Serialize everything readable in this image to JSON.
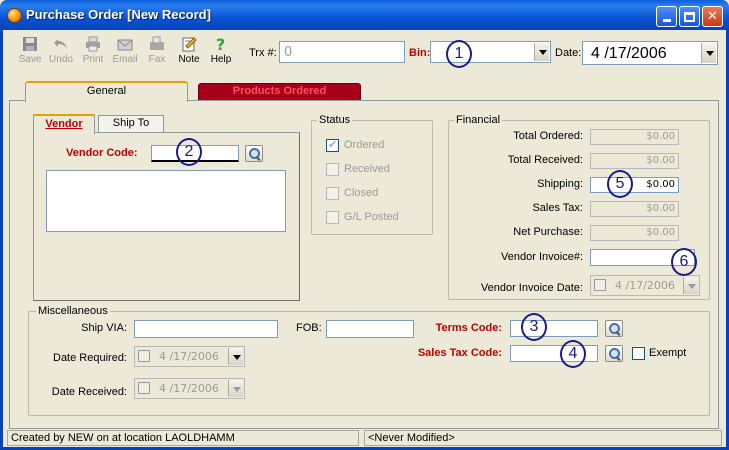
{
  "window": {
    "title": "Purchase Order [New Record]"
  },
  "toolbar": {
    "buttons": [
      {
        "label": "Save",
        "icon": "save-icon",
        "enabled": false
      },
      {
        "label": "Undo",
        "icon": "undo-icon",
        "enabled": false
      },
      {
        "label": "Print",
        "icon": "print-icon",
        "enabled": false
      },
      {
        "label": "Email",
        "icon": "email-icon",
        "enabled": false
      },
      {
        "label": "Fax",
        "icon": "fax-icon",
        "enabled": false
      },
      {
        "label": "Note",
        "icon": "note-icon",
        "enabled": true
      },
      {
        "label": "Help",
        "icon": "help-icon",
        "enabled": true
      }
    ],
    "trx_label": "Trx #:",
    "trx_value": "0",
    "bin_label": "Bin:",
    "bin_value": "",
    "date_label": "Date:",
    "date_value": "4 /17/2006"
  },
  "tabs": [
    {
      "label": "General",
      "active": true
    },
    {
      "label": "Products Ordered",
      "active": false
    }
  ],
  "vendor_tabs": [
    {
      "label": "Vendor",
      "active": true
    },
    {
      "label": "Ship To",
      "active": false
    }
  ],
  "vendor": {
    "code_label": "Vendor Code:",
    "code_value": "",
    "address": ""
  },
  "status": {
    "title": "Status",
    "items": [
      {
        "label": "Ordered",
        "checked": true
      },
      {
        "label": "Received",
        "checked": false
      },
      {
        "label": "Closed",
        "checked": false
      },
      {
        "label": "G/L Posted",
        "checked": false
      }
    ]
  },
  "financial": {
    "title": "Financial",
    "total_ordered_label": "Total Ordered:",
    "total_ordered": "$0.00",
    "total_received_label": "Total Received:",
    "total_received": "$0.00",
    "shipping_label": "Shipping:",
    "shipping": "$0.00",
    "sales_tax_label": "Sales Tax:",
    "sales_tax": "$0.00",
    "net_purchase_label": "Net Purchase:",
    "net_purchase": "$0.00",
    "vendor_invoice_label": "Vendor Invoice#:",
    "vendor_invoice": "",
    "vendor_invoice_date_label": "Vendor Invoice Date:",
    "vendor_invoice_date": "4 /17/2006"
  },
  "misc": {
    "title": "Miscellaneous",
    "ship_via_label": "Ship VIA:",
    "ship_via": "",
    "fob_label": "FOB:",
    "fob": "",
    "terms_code_label": "Terms Code:",
    "terms_code": "",
    "sales_tax_code_label": "Sales Tax Code:",
    "sales_tax_code": "",
    "exempt_label": "Exempt",
    "date_required_label": "Date Required:",
    "date_required": "4 /17/2006",
    "date_received_label": "Date Received:",
    "date_received": "4 /17/2006"
  },
  "annotations": [
    "1",
    "2",
    "3",
    "4",
    "5",
    "6"
  ],
  "statusbar": {
    "left": "Created by NEW on  at location LAOLDHAMM",
    "right": "<Never Modified>"
  },
  "colors": {
    "title_bar": "#0a53d4",
    "accent_red": "#c00000",
    "tab_products": "#a8001a",
    "annotation": "#1a1a8c"
  }
}
